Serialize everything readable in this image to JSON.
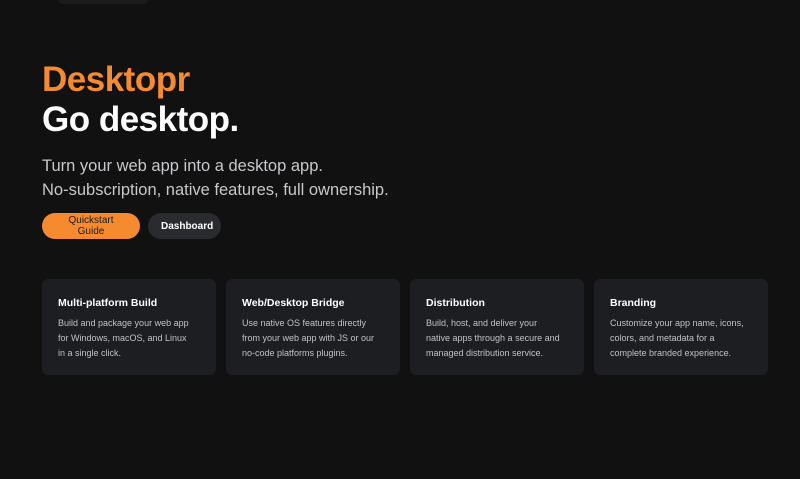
{
  "hero": {
    "brand": "Desktopr",
    "headline": "Go desktop.",
    "subtitle_line1": "Turn your web app into a desktop app.",
    "subtitle_line2": "No-subscription, native features, full ownership."
  },
  "actions": {
    "quickstart_label": "Quickstart Guide",
    "dashboard_label": "Dashboard"
  },
  "features": [
    {
      "title": "Multi-platform Build",
      "lines": [
        "Build and package your web app",
        "for Windows, macOS, and Linux",
        "in a single click."
      ]
    },
    {
      "title": "Web/Desktop Bridge",
      "lines": [
        "Use native OS features directly",
        "from your web app with JS or our",
        "no-code platforms plugins."
      ]
    },
    {
      "title": "Distribution",
      "lines": [
        "Build, host, and deliver your",
        "native apps through a secure and",
        "managed distribution service."
      ]
    },
    {
      "title": "Branding",
      "lines": [
        "Customize your app name, icons,",
        "colors, and metadata for a",
        "complete branded experience."
      ]
    }
  ],
  "colors": {
    "accent": "#f58a2e",
    "background": "#111111",
    "card": "#1d1e21",
    "secondary_button": "#2a2b2f"
  }
}
